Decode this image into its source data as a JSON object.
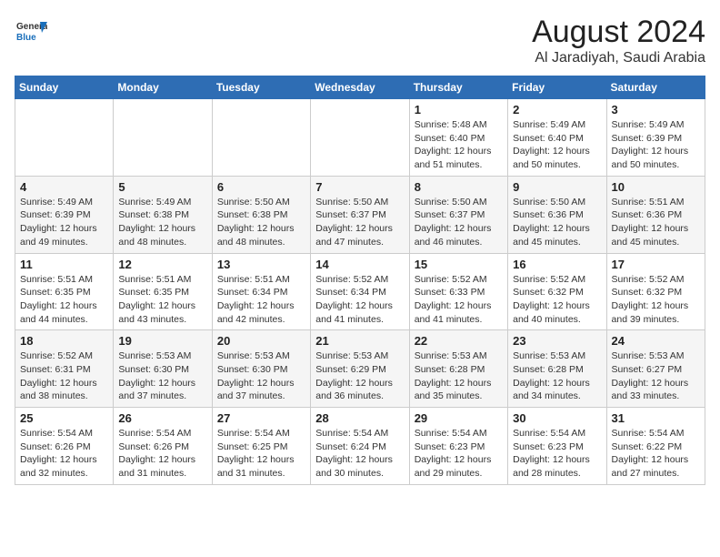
{
  "header": {
    "logo_line1": "General",
    "logo_line2": "Blue",
    "title": "August 2024",
    "subtitle": "Al Jaradiyah, Saudi Arabia"
  },
  "days_of_week": [
    "Sunday",
    "Monday",
    "Tuesday",
    "Wednesday",
    "Thursday",
    "Friday",
    "Saturday"
  ],
  "weeks": [
    [
      {
        "day": "",
        "info": ""
      },
      {
        "day": "",
        "info": ""
      },
      {
        "day": "",
        "info": ""
      },
      {
        "day": "",
        "info": ""
      },
      {
        "day": "1",
        "info": "Sunrise: 5:48 AM\nSunset: 6:40 PM\nDaylight: 12 hours\nand 51 minutes."
      },
      {
        "day": "2",
        "info": "Sunrise: 5:49 AM\nSunset: 6:40 PM\nDaylight: 12 hours\nand 50 minutes."
      },
      {
        "day": "3",
        "info": "Sunrise: 5:49 AM\nSunset: 6:39 PM\nDaylight: 12 hours\nand 50 minutes."
      }
    ],
    [
      {
        "day": "4",
        "info": "Sunrise: 5:49 AM\nSunset: 6:39 PM\nDaylight: 12 hours\nand 49 minutes."
      },
      {
        "day": "5",
        "info": "Sunrise: 5:49 AM\nSunset: 6:38 PM\nDaylight: 12 hours\nand 48 minutes."
      },
      {
        "day": "6",
        "info": "Sunrise: 5:50 AM\nSunset: 6:38 PM\nDaylight: 12 hours\nand 48 minutes."
      },
      {
        "day": "7",
        "info": "Sunrise: 5:50 AM\nSunset: 6:37 PM\nDaylight: 12 hours\nand 47 minutes."
      },
      {
        "day": "8",
        "info": "Sunrise: 5:50 AM\nSunset: 6:37 PM\nDaylight: 12 hours\nand 46 minutes."
      },
      {
        "day": "9",
        "info": "Sunrise: 5:50 AM\nSunset: 6:36 PM\nDaylight: 12 hours\nand 45 minutes."
      },
      {
        "day": "10",
        "info": "Sunrise: 5:51 AM\nSunset: 6:36 PM\nDaylight: 12 hours\nand 45 minutes."
      }
    ],
    [
      {
        "day": "11",
        "info": "Sunrise: 5:51 AM\nSunset: 6:35 PM\nDaylight: 12 hours\nand 44 minutes."
      },
      {
        "day": "12",
        "info": "Sunrise: 5:51 AM\nSunset: 6:35 PM\nDaylight: 12 hours\nand 43 minutes."
      },
      {
        "day": "13",
        "info": "Sunrise: 5:51 AM\nSunset: 6:34 PM\nDaylight: 12 hours\nand 42 minutes."
      },
      {
        "day": "14",
        "info": "Sunrise: 5:52 AM\nSunset: 6:34 PM\nDaylight: 12 hours\nand 41 minutes."
      },
      {
        "day": "15",
        "info": "Sunrise: 5:52 AM\nSunset: 6:33 PM\nDaylight: 12 hours\nand 41 minutes."
      },
      {
        "day": "16",
        "info": "Sunrise: 5:52 AM\nSunset: 6:32 PM\nDaylight: 12 hours\nand 40 minutes."
      },
      {
        "day": "17",
        "info": "Sunrise: 5:52 AM\nSunset: 6:32 PM\nDaylight: 12 hours\nand 39 minutes."
      }
    ],
    [
      {
        "day": "18",
        "info": "Sunrise: 5:52 AM\nSunset: 6:31 PM\nDaylight: 12 hours\nand 38 minutes."
      },
      {
        "day": "19",
        "info": "Sunrise: 5:53 AM\nSunset: 6:30 PM\nDaylight: 12 hours\nand 37 minutes."
      },
      {
        "day": "20",
        "info": "Sunrise: 5:53 AM\nSunset: 6:30 PM\nDaylight: 12 hours\nand 37 minutes."
      },
      {
        "day": "21",
        "info": "Sunrise: 5:53 AM\nSunset: 6:29 PM\nDaylight: 12 hours\nand 36 minutes."
      },
      {
        "day": "22",
        "info": "Sunrise: 5:53 AM\nSunset: 6:28 PM\nDaylight: 12 hours\nand 35 minutes."
      },
      {
        "day": "23",
        "info": "Sunrise: 5:53 AM\nSunset: 6:28 PM\nDaylight: 12 hours\nand 34 minutes."
      },
      {
        "day": "24",
        "info": "Sunrise: 5:53 AM\nSunset: 6:27 PM\nDaylight: 12 hours\nand 33 minutes."
      }
    ],
    [
      {
        "day": "25",
        "info": "Sunrise: 5:54 AM\nSunset: 6:26 PM\nDaylight: 12 hours\nand 32 minutes."
      },
      {
        "day": "26",
        "info": "Sunrise: 5:54 AM\nSunset: 6:26 PM\nDaylight: 12 hours\nand 31 minutes."
      },
      {
        "day": "27",
        "info": "Sunrise: 5:54 AM\nSunset: 6:25 PM\nDaylight: 12 hours\nand 31 minutes."
      },
      {
        "day": "28",
        "info": "Sunrise: 5:54 AM\nSunset: 6:24 PM\nDaylight: 12 hours\nand 30 minutes."
      },
      {
        "day": "29",
        "info": "Sunrise: 5:54 AM\nSunset: 6:23 PM\nDaylight: 12 hours\nand 29 minutes."
      },
      {
        "day": "30",
        "info": "Sunrise: 5:54 AM\nSunset: 6:23 PM\nDaylight: 12 hours\nand 28 minutes."
      },
      {
        "day": "31",
        "info": "Sunrise: 5:54 AM\nSunset: 6:22 PM\nDaylight: 12 hours\nand 27 minutes."
      }
    ]
  ]
}
